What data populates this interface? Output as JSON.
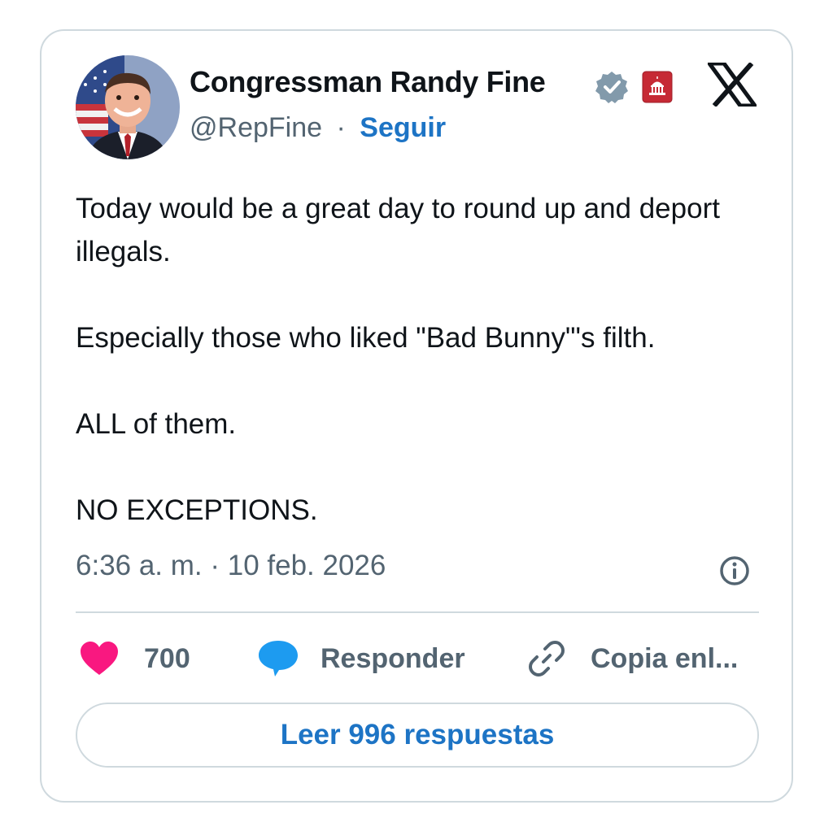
{
  "author": {
    "name": "Congressman Randy Fine",
    "handle": "@RepFine",
    "separator": "·",
    "follow_label": "Seguir",
    "verified_icon": "verified-badge-icon",
    "affiliation_icon": "us-capitol-badge-icon"
  },
  "tweet": {
    "paragraphs": [
      "Today would be a great day to round up and deport illegals.",
      "Especially those who liked \"Bad Bunny\"'s filth.",
      "ALL of them.",
      "NO EXCEPTIONS."
    ],
    "timestamp": "6:36 a. m. · 10 feb. 2026"
  },
  "actions": {
    "likes": "700",
    "reply_label": "Responder",
    "copy_label": "Copia enl..."
  },
  "read_replies_label": "Leer 996 respuestas",
  "colors": {
    "link_blue": "#1d74c5",
    "heart_pink": "#f91880",
    "reply_blue": "#1d9bf0",
    "muted_gray": "#536471",
    "border": "#cfd9de"
  }
}
